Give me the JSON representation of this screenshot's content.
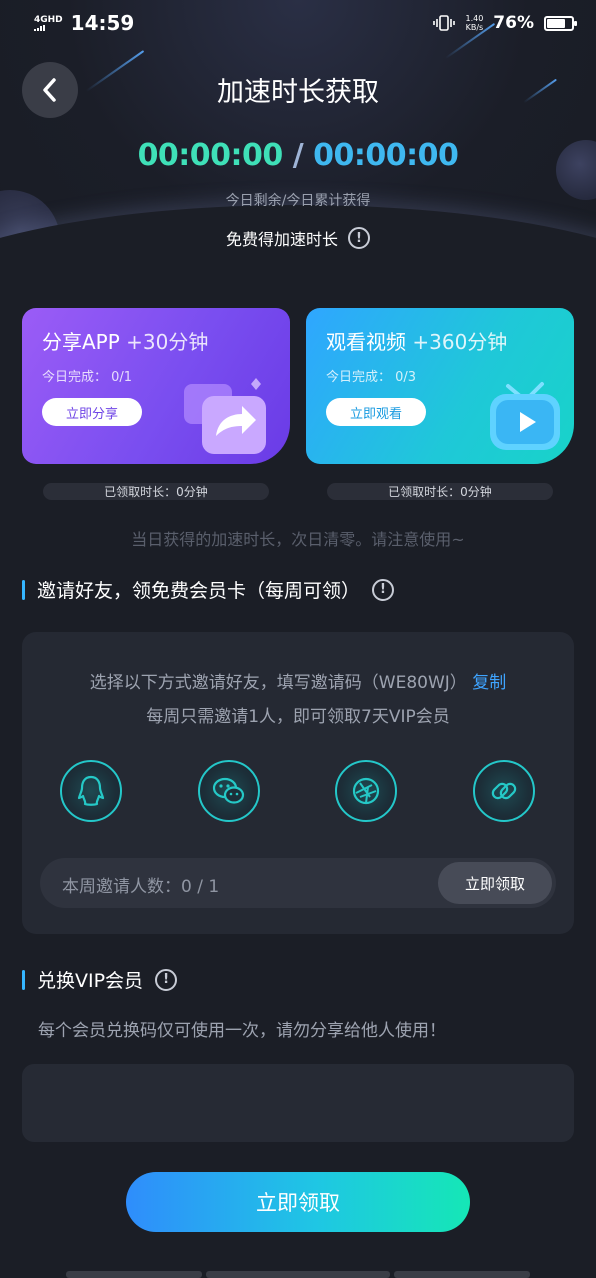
{
  "status_bar": {
    "network": "4GHD",
    "time": "14:59",
    "speed_value": "1.40",
    "speed_unit": "KB/s",
    "battery": "76%",
    "battery_level": 0.76
  },
  "header": {
    "back_icon": "chevron-left-icon",
    "title": "加速时长获取"
  },
  "timer": {
    "remaining": "00:00:00",
    "separator": " / ",
    "total": "00:00:00",
    "caption": "今日剩余/今日累计获得",
    "free_label": "免费得加速时长",
    "info_icon": "info-icon"
  },
  "tasks": [
    {
      "title": "分享APP",
      "bonus": "+30分钟",
      "progress": "今日完成： 0/1",
      "button": "立即分享",
      "claimed": "已领取时长：0分钟",
      "icon": "share-arrow-icon"
    },
    {
      "title": "观看视频",
      "bonus": "+360分钟",
      "progress": "今日完成： 0/3",
      "button": "立即观看",
      "claimed": "已领取时长：0分钟",
      "icon": "tv-play-icon"
    }
  ],
  "tasks_note": "当日获得的加速时长，次日清零。请注意使用~",
  "invite": {
    "heading": "邀请好友，领免费会员卡（每周可领）",
    "line1": "选择以下方式邀请好友，填写邀请码（WE80WJ）",
    "copy": "复制",
    "line2": "每周只需邀请1人，即可领取7天VIP会员",
    "channels": [
      "qq-icon",
      "wechat-icon",
      "moments-icon",
      "link-icon"
    ],
    "count_label": "本周邀请人数：0 / 1",
    "claim_button": "立即领取"
  },
  "redeem": {
    "heading": "兑换VIP会员",
    "note": "每个会员兑换码仅可使用一次，请勿分享给他人使用！",
    "input_value": "",
    "input_placeholder": "",
    "submit": "立即领取"
  },
  "colors": {
    "background": "#1b1e26",
    "timer_green": "#3fe0b8",
    "timer_blue": "#3fb8f0",
    "accent_blue": "#3fa4ff",
    "share_card": "#8a52f2",
    "video_card": "#22b8e6"
  }
}
